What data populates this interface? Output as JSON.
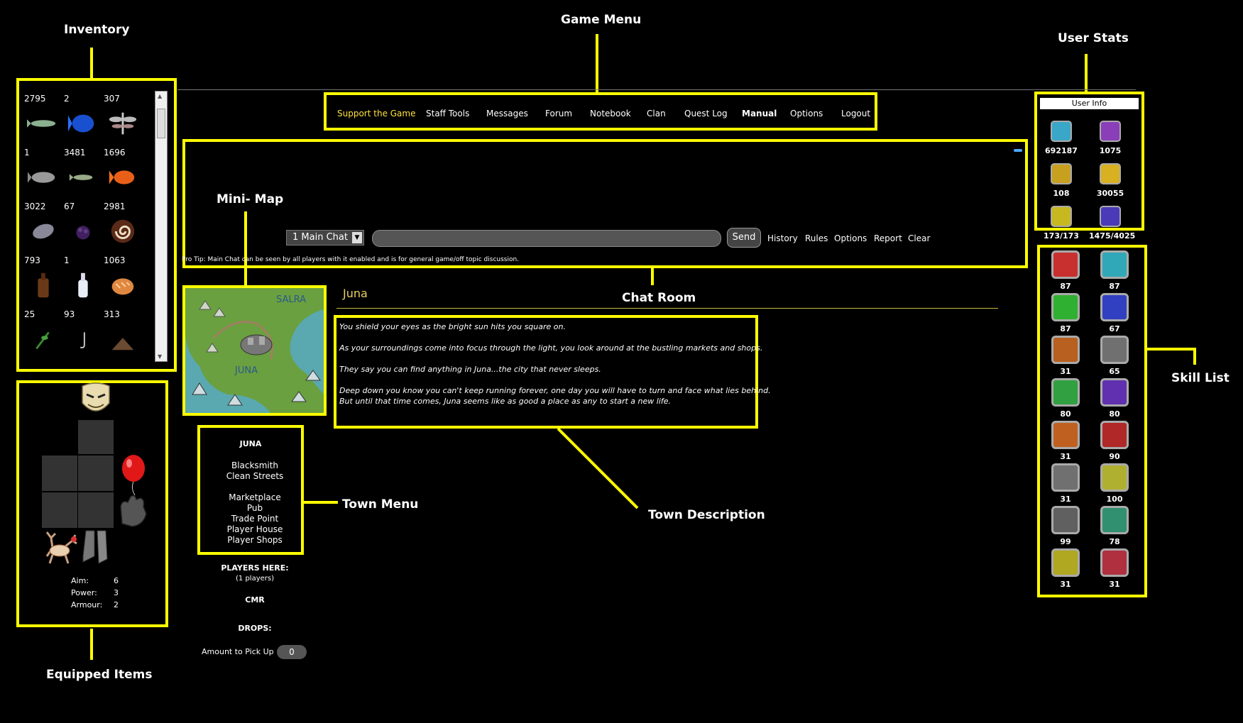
{
  "callouts": {
    "inventory": "Inventory",
    "game_menu": "Game Menu",
    "user_stats": "User Stats",
    "mini_map": "Mini- Map",
    "chat_room": "Chat Room",
    "skill_list": "Skill List",
    "town_menu": "Town Menu",
    "town_description": "Town Description",
    "equipped_items": "Equipped Items"
  },
  "inventory": {
    "items": [
      {
        "count": "2795",
        "icon": "fish-icon"
      },
      {
        "count": "2",
        "icon": "blue-fish-icon"
      },
      {
        "count": "307",
        "icon": "dragonfly-icon"
      },
      {
        "count": "1",
        "icon": "grey-fish-icon"
      },
      {
        "count": "3481",
        "icon": "small-fish-icon"
      },
      {
        "count": "1696",
        "icon": "orange-fish-icon"
      },
      {
        "count": "3022",
        "icon": "flat-fish-icon"
      },
      {
        "count": "67",
        "icon": "blackberry-icon"
      },
      {
        "count": "2981",
        "icon": "swiss-roll-icon"
      },
      {
        "count": "793",
        "icon": "bottle-icon"
      },
      {
        "count": "1",
        "icon": "milk-bottle-icon"
      },
      {
        "count": "1063",
        "icon": "bread-icon"
      },
      {
        "count": "25",
        "icon": "herb-icon"
      },
      {
        "count": "93",
        "icon": "hook-icon"
      },
      {
        "count": "313",
        "icon": "item-icon"
      }
    ]
  },
  "equipped": {
    "aim_label": "Aim:",
    "aim": "6",
    "power_label": "Power:",
    "power": "3",
    "armour_label": "Armour:",
    "armour": "2"
  },
  "menu": {
    "items": [
      "Support the Game",
      "Staff Tools",
      "Messages",
      "Forum",
      "Notebook",
      "Clan",
      "Quest Log",
      "Manual",
      "Options",
      "Logout"
    ]
  },
  "chat": {
    "channel": "1 Main Chat",
    "send": "Send",
    "links": [
      "History",
      "Rules",
      "Options",
      "Report",
      "Clear"
    ],
    "tip": "Pro Tip: Main Chat can be seen by all players with it enabled and is for general game/off topic discussion."
  },
  "map": {
    "label_north": "SALRA",
    "label_south": "JUNA"
  },
  "town": {
    "title": "JUNA",
    "group1": [
      "Blacksmith",
      "Clean Streets"
    ],
    "group2": [
      "Marketplace",
      "Pub",
      "Trade Point",
      "Player House",
      "Player Shops"
    ],
    "players_here": "PLAYERS HERE:",
    "players_count": "(1 players)",
    "player_name": "CMR",
    "drops": "DROPS:",
    "pickup_label": "Amount to Pick Up",
    "pickup_value": "0"
  },
  "location": {
    "name": "Juna",
    "description": [
      "You shield your eyes as the bright sun hits you square on.",
      "As your surroundings come into focus through the light, you look around at the bustling markets and shops.",
      "They say you can find anything in Juna...the city that never sleeps.",
      "Deep down you know you can't keep running forever, one day you will have to turn and face what lies behind.",
      "But until that time comes, Juna seems like as good a place as any to start a new life."
    ]
  },
  "user_info": {
    "title": "User Info",
    "stats": [
      {
        "value": "692187",
        "icon": "star-icon",
        "color": "#3aa6c8"
      },
      {
        "value": "1075",
        "icon": "tl-icon",
        "color": "#8a3fb8"
      },
      {
        "value": "108",
        "icon": "scroll-icon",
        "color": "#c8a020"
      },
      {
        "value": "30055",
        "icon": "coin-icon",
        "color": "#d8b020"
      },
      {
        "value": "173/173",
        "icon": "heart-icon",
        "color": "#c8b820"
      },
      {
        "value": "1475/4025",
        "icon": "energy-icon",
        "color": "#4a3ab8"
      }
    ]
  },
  "skills": [
    {
      "value": "87",
      "icon": "swords-icon",
      "color": "#c83030"
    },
    {
      "value": "87",
      "icon": "shield-icon",
      "color": "#30a8b8"
    },
    {
      "value": "87",
      "icon": "heart-icon",
      "color": "#30b030"
    },
    {
      "value": "67",
      "icon": "crossbow-icon",
      "color": "#3040c0"
    },
    {
      "value": "31",
      "icon": "sickle-icon",
      "color": "#b86020"
    },
    {
      "value": "65",
      "icon": "pickaxe-icon",
      "color": "#707070"
    },
    {
      "value": "80",
      "icon": "hammer-icon",
      "color": "#30a040"
    },
    {
      "value": "80",
      "icon": "wand-icon",
      "color": "#6030b0"
    },
    {
      "value": "31",
      "icon": "ingot-icon",
      "color": "#c06020"
    },
    {
      "value": "90",
      "icon": "anvil-icon",
      "color": "#b02828"
    },
    {
      "value": "31",
      "icon": "house-icon",
      "color": "#707070"
    },
    {
      "value": "100",
      "icon": "blade-icon",
      "color": "#b0b030"
    },
    {
      "value": "99",
      "icon": "keyhole-icon",
      "color": "#606060"
    },
    {
      "value": "78",
      "icon": "needle-icon",
      "color": "#309070"
    },
    {
      "value": "31",
      "icon": "boot-icon",
      "color": "#b0a820"
    },
    {
      "value": "31",
      "icon": "claw-icon",
      "color": "#b03040"
    }
  ]
}
